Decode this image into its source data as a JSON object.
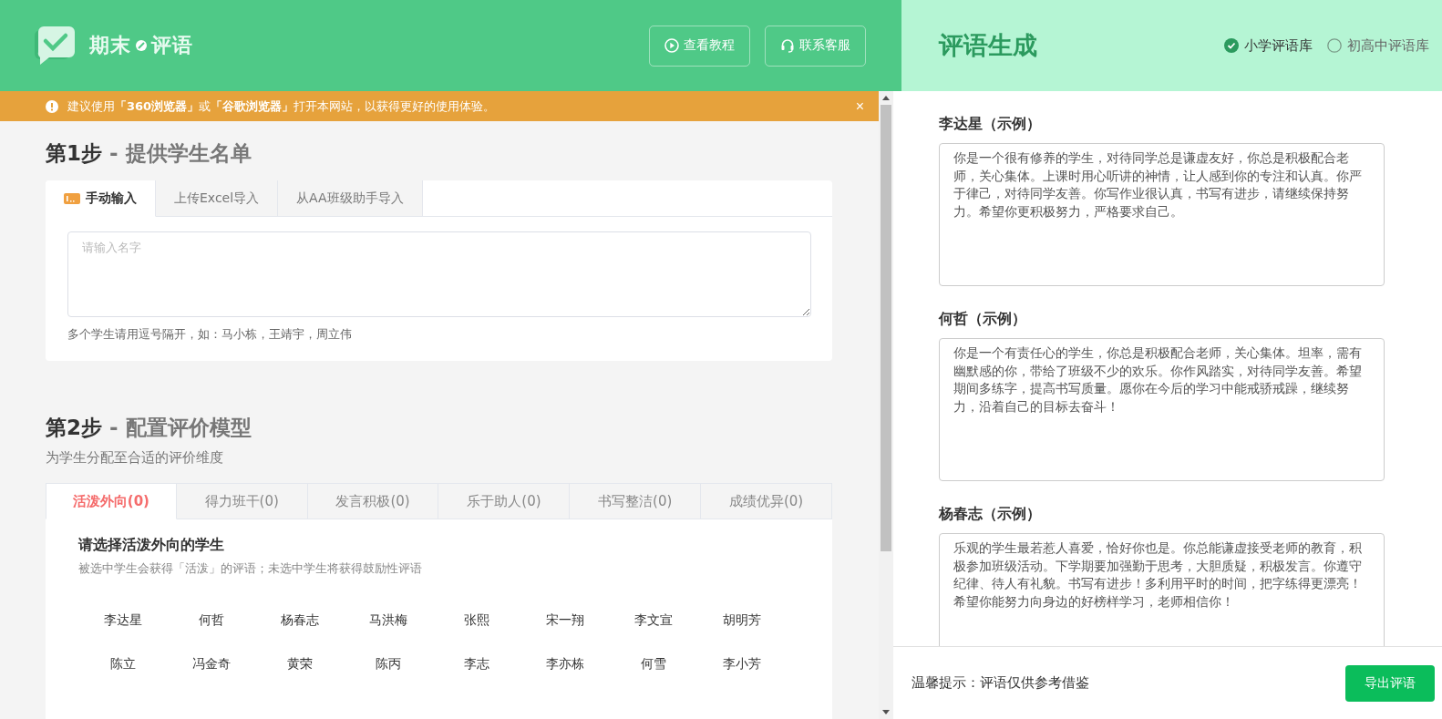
{
  "header": {
    "logo": {
      "left": "期末",
      "right": "评语"
    },
    "buttons": [
      {
        "label": "查看教程",
        "kind": "play"
      },
      {
        "label": "联系客服",
        "kind": "headset"
      }
    ]
  },
  "notice": {
    "text": "建议使用**「360浏览器」**或**「谷歌浏览器」**打开本网站，以获得更好的使用体验。",
    "close": "×"
  },
  "step1": {
    "step": "第1步",
    "title": "- 提供学生名单",
    "tabs": [
      {
        "label": "手动输入",
        "selected": true
      },
      {
        "label": "上传Excel导入",
        "selected": false
      },
      {
        "label": "从AA班级助手导入",
        "selected": false
      }
    ],
    "input": {
      "placeholder": "请输入名字"
    },
    "hint": "多个学生请用逗号隔开，如：马小栋，王靖宇，周立伟"
  },
  "step2": {
    "step": "第2步",
    "title": "- 配置评价模型",
    "subtitle": "为学生分配至合适的评价维度",
    "tabs": [
      {
        "label": "活泼外向(0)",
        "selected": true
      },
      {
        "label": "得力班干(0)",
        "selected": false
      },
      {
        "label": "发言积极(0)",
        "selected": false
      },
      {
        "label": "乐于助人(0)",
        "selected": false
      },
      {
        "label": "书写整洁(0)",
        "selected": false
      },
      {
        "label": "成绩优异(0)",
        "selected": false
      }
    ],
    "prompt": "请选择活泼外向的学生",
    "description": "被选中学生会获得「活泼」的评语；未选中学生将获得鼓励性评语",
    "students": [
      {
        "name": "李达星",
        "selected": false
      },
      {
        "name": "何哲",
        "selected": false
      },
      {
        "name": "杨春志",
        "selected": false
      },
      {
        "name": "马洪梅",
        "selected": false
      },
      {
        "name": "张熙",
        "selected": false
      },
      {
        "name": "宋一翔",
        "selected": false
      },
      {
        "name": "李文宣",
        "selected": false
      },
      {
        "name": "胡明芳",
        "selected": false
      },
      {
        "name": "陈立",
        "selected": false
      },
      {
        "name": "冯金奇",
        "selected": false
      },
      {
        "name": "黄荣",
        "selected": false
      },
      {
        "name": "陈丙",
        "selected": false
      },
      {
        "name": "李志",
        "selected": false
      },
      {
        "name": "李亦栋",
        "selected": false
      },
      {
        "name": "何雪",
        "selected": false
      },
      {
        "name": "李小芳",
        "selected": false
      }
    ]
  },
  "panel": {
    "title": "评语生成",
    "libraries": [
      {
        "label": "小学评语库",
        "selected": true
      },
      {
        "label": "初高中评语库",
        "selected": false
      }
    ],
    "comments": [
      {
        "name": "李达星（示例）",
        "text": "你是一个很有修养的学生，对待同学总是谦虚友好，你总是积极配合老师，关心集体。上课时用心听讲的神情，让人感到你的专注和认真。你严于律己，对待同学友善。你写作业很认真，书写有进步，请继续保持努力。希望你更积极努力，严格要求自己。"
      },
      {
        "name": "何哲（示例）",
        "text": "你是一个有责任心的学生，你总是积极配合老师，关心集体。坦率，需有幽默感的你，带给了班级不少的欢乐。你作风踏实，对待同学友善。希望期间多练字，提高书写质量。愿你在今后的学习中能戒骄戒躁，继续努力，沿着自己的目标去奋斗！"
      },
      {
        "name": "杨春志（示例）",
        "text": "乐观的学生最若惹人喜爱，恰好你也是。你总能谦虚接受老师的教育，积极参加班级活动。下学期要加强勤于思考，大胆质疑，积极发言。你遵守纪律、待人有礼貌。书写有进步！多利用平时的时间，把字练得更漂亮！希望你能努力向身边的好榜样学习，老师相信你！"
      }
    ],
    "footer": {
      "tip": "温馨提示：评语仅供参考借鉴",
      "export": "导出评语"
    }
  }
}
